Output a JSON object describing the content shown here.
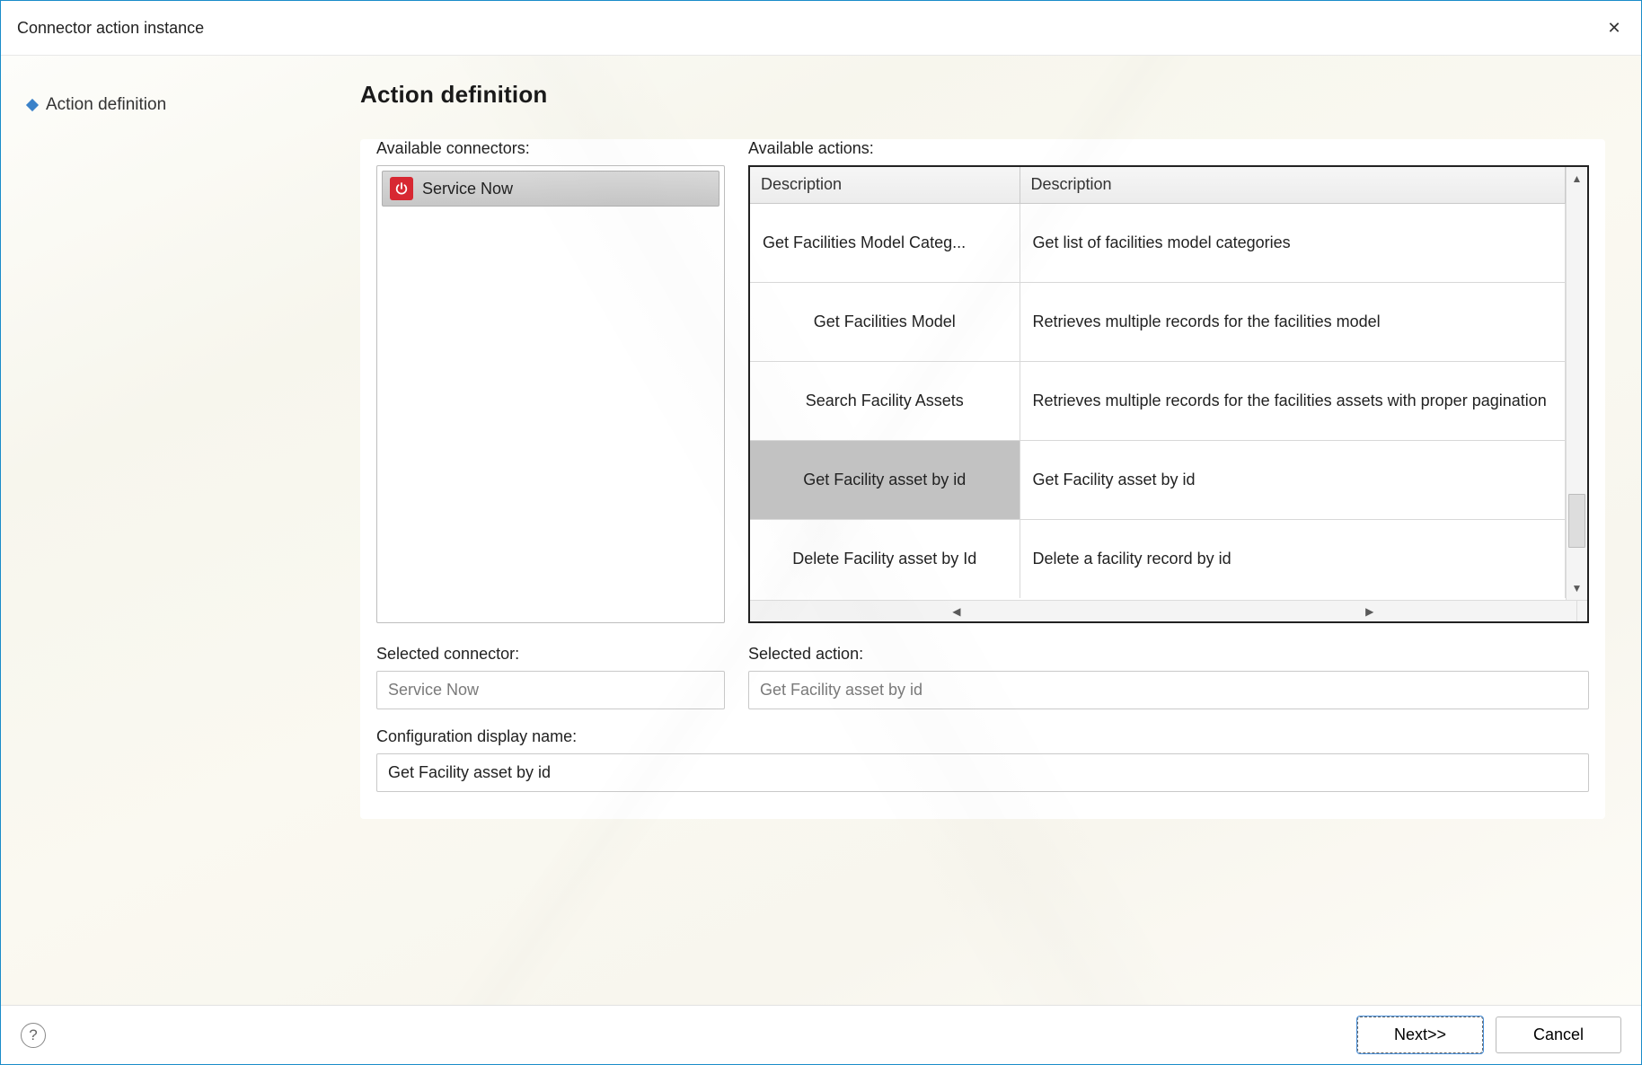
{
  "window": {
    "title": "Connector action instance"
  },
  "sidebar": {
    "items": [
      {
        "label": "Action definition"
      }
    ]
  },
  "page": {
    "heading": "Action definition"
  },
  "connectors": {
    "label": "Available connectors:",
    "items": [
      {
        "name": "Service Now",
        "icon": "power-icon"
      }
    ]
  },
  "actions": {
    "label": "Available actions:",
    "columns": [
      "Description",
      "Description"
    ],
    "rows": [
      {
        "name": "Get Facilities Model Categ...",
        "desc": "Get list of facilities model categories",
        "selected": false
      },
      {
        "name": "Get Facilities Model",
        "desc": "Retrieves multiple records for the facilities model",
        "selected": false
      },
      {
        "name": "Search Facility Assets",
        "desc": "Retrieves multiple records for the facilities assets with proper pagination",
        "selected": false
      },
      {
        "name": "Get Facility asset by id",
        "desc": "Get Facility asset by id",
        "selected": true
      },
      {
        "name": "Delete Facility asset by Id",
        "desc": "Delete a facility record by id",
        "selected": false
      }
    ]
  },
  "selected_connector": {
    "label": "Selected connector:",
    "value": "Service Now"
  },
  "selected_action": {
    "label": "Selected action:",
    "value": "Get Facility asset by id"
  },
  "config_name": {
    "label": "Configuration display name:",
    "value": "Get Facility asset by id"
  },
  "footer": {
    "next_label": "Next>>",
    "cancel_label": "Cancel"
  }
}
